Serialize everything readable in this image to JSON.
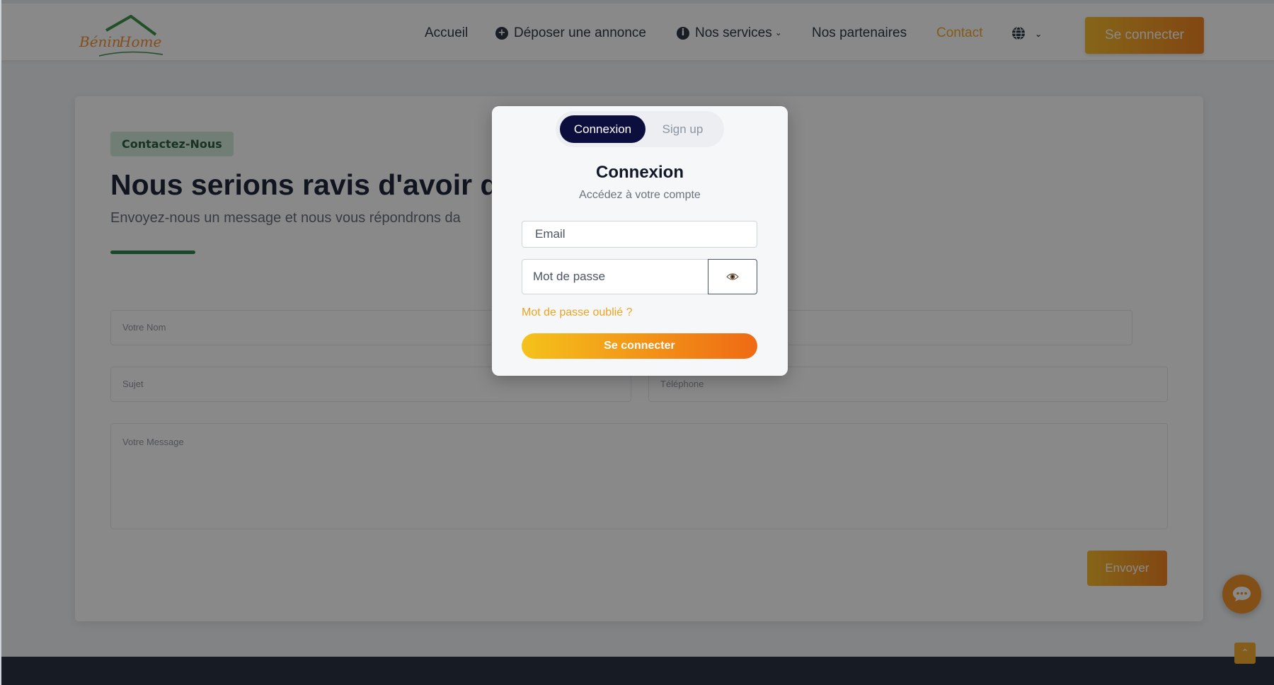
{
  "header": {
    "nav": {
      "accueil": "Accueil",
      "deposer": "Déposer une annonce",
      "services": "Nos services",
      "partenaires": "Nos partenaires",
      "contact": "Contact"
    },
    "login_label": "Se connecter"
  },
  "contact": {
    "tag": "Contactez-Nous",
    "title": "Nous serions ravis d'avoir d",
    "subtitle": "Envoyez-nous un message et nous vous répondrons da",
    "fields": {
      "name_placeholder": "Votre Nom",
      "subject_placeholder": "Sujet",
      "phone_placeholder": "Téléphone",
      "message_placeholder": "Votre Message"
    },
    "send_label": "Envoyer"
  },
  "modal": {
    "tab_login": "Connexion",
    "tab_signup": "Sign up",
    "title": "Connexion",
    "subtitle": "Accédez à votre compte",
    "email_placeholder": "Email",
    "password_placeholder": "Mot de passe",
    "forgot": "Mot de passe oublié ?",
    "submit": "Se connecter"
  },
  "colors": {
    "accent": "#f0a321",
    "brand_navy": "#0c0f3d",
    "brand_green": "#1e7a3e"
  },
  "icons": [
    "plus-circle-icon",
    "info-icon",
    "chevron-down-icon",
    "globe-icon",
    "eye-icon",
    "chat-icon",
    "arrow-up-icon"
  ]
}
